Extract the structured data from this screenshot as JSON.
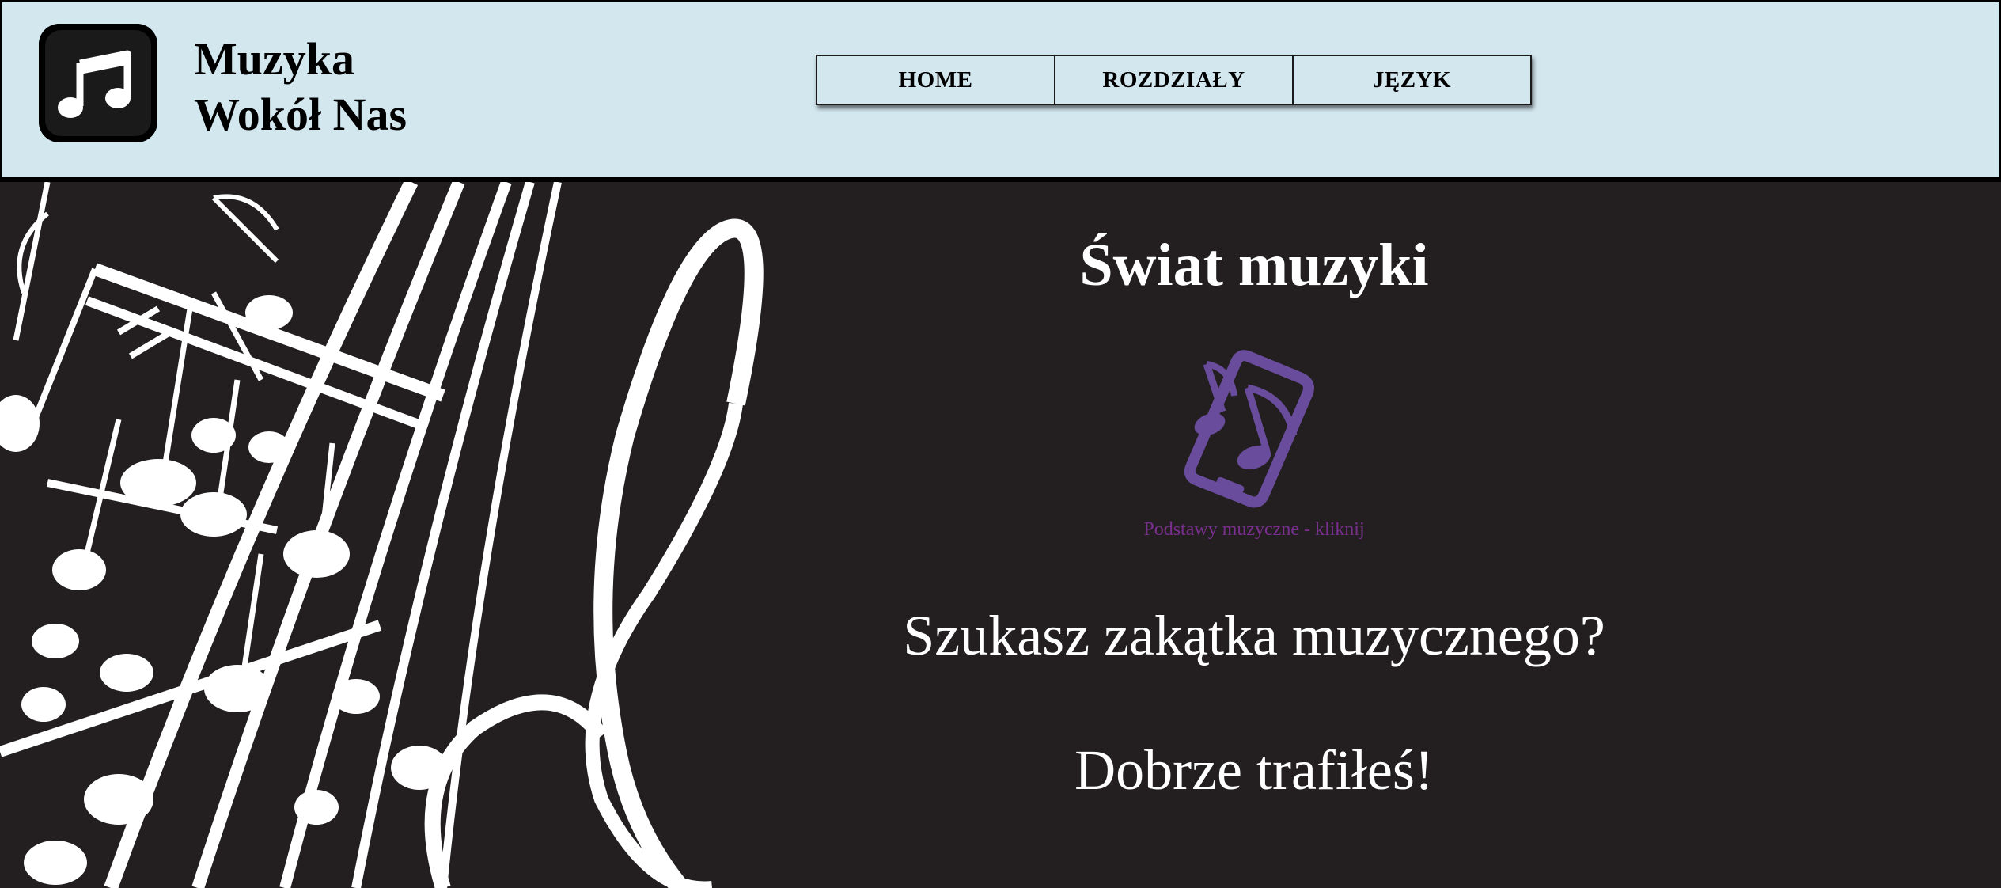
{
  "header": {
    "logo_icon": "music-note-icon",
    "title_line1": "Muzyka",
    "title_line2": "Wokół Nas",
    "background_color": "#d3e7ef"
  },
  "nav": {
    "items": [
      {
        "label": "HOME"
      },
      {
        "label": "ROZDZIAŁY"
      },
      {
        "label": "JĘZYK"
      }
    ]
  },
  "hero": {
    "title": "Świat muzyki",
    "promo_icon": "phone-music-icon",
    "promo_caption": "Podstawy muzyczne - kliknij",
    "promo_color": "#6a4c9c",
    "tagline_1": "Szukasz zakątka muzycznego?",
    "tagline_2": "Dobrze trafiłeś!",
    "background_color": "#231f20"
  }
}
